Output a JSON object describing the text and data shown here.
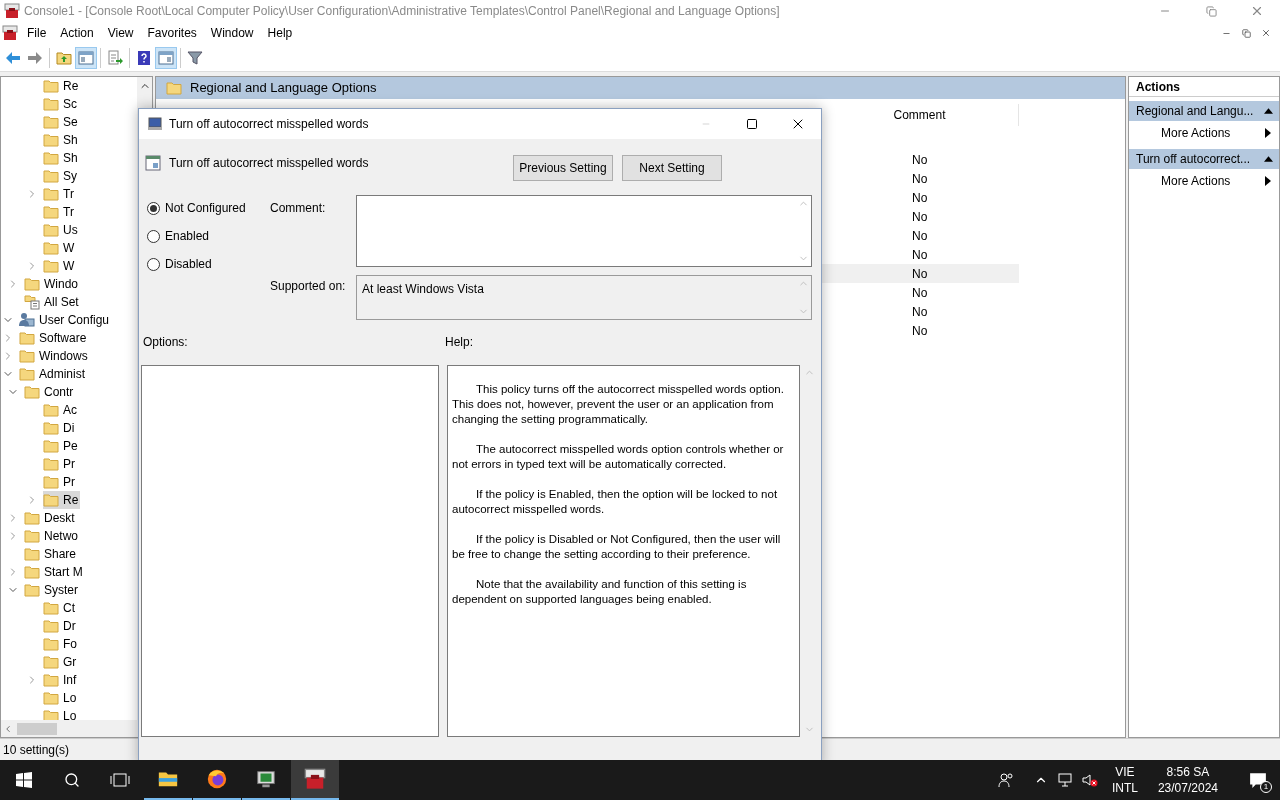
{
  "window": {
    "title": "Console1 - [Console Root\\Local Computer Policy\\User Configuration\\Administrative Templates\\Control Panel\\Regional and Language Options]"
  },
  "menu": [
    "File",
    "Action",
    "View",
    "Favorites",
    "Window",
    "Help"
  ],
  "toolbar": [
    [
      {
        "kind": "back",
        "pressed": false
      },
      {
        "kind": "forward",
        "pressed": false
      }
    ],
    [
      {
        "kind": "up",
        "pressed": false
      },
      {
        "kind": "tree-toggle",
        "pressed": true
      }
    ],
    [
      {
        "kind": "export",
        "pressed": false
      }
    ],
    [
      {
        "kind": "help",
        "pressed": false
      },
      {
        "kind": "action-toggle",
        "pressed": true
      }
    ],
    [
      {
        "kind": "filter",
        "pressed": false
      }
    ]
  ],
  "tree": [
    {
      "children": [
        {
          "children": [
            {
              "children": [
                {
                  "label": "Re",
                  "kind": "folder",
                  "selected": false
                },
                {
                  "label": "Sc",
                  "kind": "folder",
                  "selected": false
                },
                {
                  "label": "Se",
                  "kind": "folder",
                  "selected": false
                },
                {
                  "label": "Sh",
                  "kind": "folder",
                  "selected": false
                },
                {
                  "label": "Sh",
                  "kind": "folder",
                  "selected": false
                },
                {
                  "label": "Sy",
                  "kind": "folder",
                  "selected": false
                },
                {
                  "label": "Tr",
                  "kind": "folder",
                  "expanded": false,
                  "selected": false
                },
                {
                  "label": "Tr",
                  "kind": "folder",
                  "selected": false
                },
                {
                  "label": "Us",
                  "kind": "folder",
                  "selected": false
                },
                {
                  "label": "W",
                  "kind": "folder",
                  "selected": false
                },
                {
                  "label": "W",
                  "kind": "folder",
                  "expanded": false,
                  "selected": false
                }
              ]
            },
            {
              "label": "Windo",
              "kind": "folder",
              "expanded": false,
              "selected": false
            },
            {
              "label": "All Set",
              "kind": "settings-list",
              "selected": false
            }
          ]
        }
      ]
    },
    {
      "label": "User Configu",
      "kind": "user-config",
      "expanded": true,
      "selected": false,
      "children": [
        {
          "label": "Software",
          "kind": "folder",
          "expanded": false,
          "selected": false
        },
        {
          "label": "Windows",
          "kind": "folder",
          "expanded": false,
          "selected": false
        },
        {
          "label": "Administ",
          "kind": "folder",
          "expanded": true,
          "selected": false,
          "children": [
            {
              "label": "Contr",
              "kind": "folder",
              "expanded": true,
              "selected": false,
              "children": [
                {
                  "label": "Ac",
                  "kind": "folder",
                  "selected": false
                },
                {
                  "label": "Di",
                  "kind": "folder",
                  "selected": false
                },
                {
                  "label": "Pe",
                  "kind": "folder",
                  "selected": false
                },
                {
                  "label": "Pr",
                  "kind": "folder",
                  "selected": false
                },
                {
                  "label": "Pr",
                  "kind": "folder",
                  "selected": false
                },
                {
                  "label": "Re",
                  "kind": "folder",
                  "expanded": false,
                  "selected": true
                }
              ]
            },
            {
              "label": "Deskt",
              "kind": "folder",
              "expanded": false,
              "selected": false
            },
            {
              "label": "Netwo",
              "kind": "folder",
              "expanded": false,
              "selected": false
            },
            {
              "label": "Share",
              "kind": "folder",
              "selected": false
            },
            {
              "label": "Start M",
              "kind": "folder",
              "expanded": false,
              "selected": false
            },
            {
              "label": "Syster",
              "kind": "folder",
              "expanded": true,
              "selected": false,
              "children": [
                {
                  "label": "Ct",
                  "kind": "folder",
                  "selected": false
                },
                {
                  "label": "Dr",
                  "kind": "folder",
                  "selected": false
                },
                {
                  "label": "Fo",
                  "kind": "folder",
                  "selected": false
                },
                {
                  "label": "Gr",
                  "kind": "folder",
                  "selected": false
                },
                {
                  "label": "Inf",
                  "kind": "folder",
                  "expanded": false,
                  "selected": false
                },
                {
                  "label": "Lo",
                  "kind": "folder",
                  "selected": false
                },
                {
                  "label": "Lo",
                  "kind": "folder",
                  "selected": false
                }
              ]
            }
          ]
        }
      ]
    }
  ],
  "center": {
    "header": "Regional and Language Options",
    "columns": [
      "Comment"
    ],
    "rows": [
      {
        "comment": "No",
        "selected": false
      },
      {
        "comment": "No",
        "selected": false
      },
      {
        "comment": "No",
        "selected": false
      },
      {
        "comment": "No",
        "selected": false
      },
      {
        "comment": "No",
        "selected": false
      },
      {
        "comment": "No",
        "selected": false
      },
      {
        "comment": "No",
        "selected": true
      },
      {
        "comment": "No",
        "selected": false
      },
      {
        "comment": "No",
        "selected": false
      },
      {
        "comment": "No",
        "selected": false
      }
    ]
  },
  "actions": {
    "title": "Actions",
    "groups": [
      {
        "title": "Regional and Langu...",
        "expanded": true,
        "items": [
          "More Actions"
        ]
      },
      {
        "title": "Turn off autocorrect...",
        "expanded": true,
        "items": [
          "More Actions"
        ]
      }
    ]
  },
  "status_bar": "10 setting(s)",
  "dialog": {
    "title": "Turn off autocorrect misspelled words",
    "setting_name": "Turn off autocorrect misspelled words",
    "nav_buttons": [
      "Previous Setting",
      "Next Setting"
    ],
    "states": [
      {
        "label": "Not Configured",
        "selected": true
      },
      {
        "label": "Enabled",
        "selected": false
      },
      {
        "label": "Disabled",
        "selected": false
      }
    ],
    "comment_label": "Comment:",
    "supported_label": "Supported on:",
    "supported_value": "At least Windows Vista",
    "options_label": "Options:",
    "help_label": "Help:",
    "help": [
      "This policy turns off the autocorrect misspelled words option. This does not, however, prevent the user or an application from changing the setting programmatically.",
      "The autocorrect misspelled words option controls whether or not errors in typed text will be automatically corrected.",
      "If the policy is Enabled, then the option will be locked to not autocorrect misspelled words.",
      "If the policy is Disabled or Not Configured, then the user will be free to change the setting according to their preference.",
      "Note that the availability and function of this setting is dependent on supported languages being enabled."
    ]
  },
  "taskbar": {
    "apps": [
      {
        "kind": "file-explorer",
        "selected": false
      },
      {
        "kind": "firefox",
        "selected": false
      },
      {
        "kind": "monitor",
        "selected": false
      },
      {
        "kind": "console",
        "selected": true
      }
    ],
    "language": [
      "VIE",
      "INTL"
    ],
    "time": "8:56 SA",
    "date": "23/07/2024",
    "notifications": "1"
  }
}
